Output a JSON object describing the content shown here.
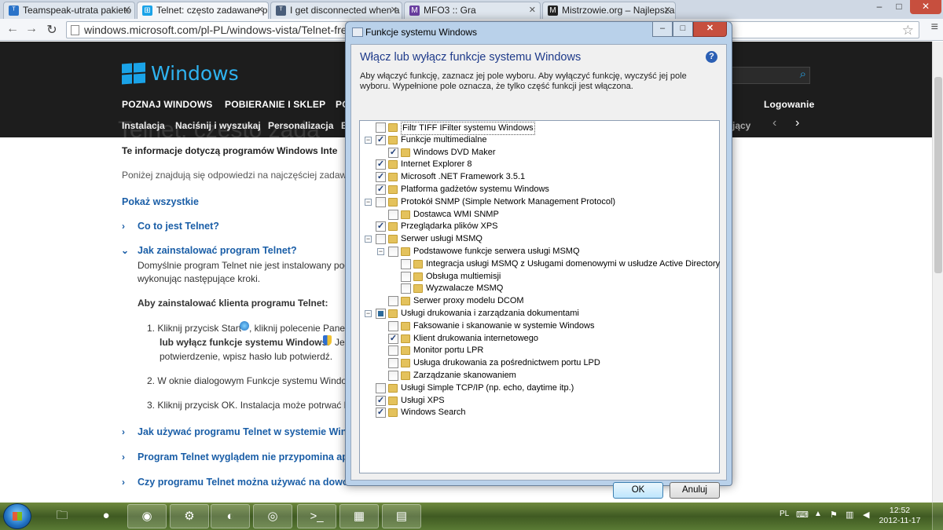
{
  "browser": {
    "tabs": [
      {
        "title": "Teamspeak-utrata pakietó",
        "icon": "teamspeak-icon",
        "color": "#2a73c9"
      },
      {
        "title": "Telnet: często zadawane p",
        "icon": "windows-flag-icon",
        "color": "#1aa3e8"
      },
      {
        "title": "I get disconnected when a",
        "icon": "teamspeak-icon",
        "color": "#4a5e7a"
      },
      {
        "title": "MFO3 :: Gra",
        "icon": "mfo-icon",
        "color": "#6a3fa0"
      },
      {
        "title": "Mistrzowie.org – Najlepsza",
        "icon": "m-icon",
        "color": "#222222"
      }
    ],
    "url": "windows.microsoft.com/pl-PL/windows-vista/Telnet-freq",
    "window_controls": {
      "minimize": "–",
      "maximize": "□",
      "close": "✕"
    }
  },
  "site": {
    "logo": "Windows",
    "nav": [
      "POZNAJ WINDOWS",
      "POBIERANIE I SKLEP",
      "PO"
    ],
    "login": "Logowanie",
    "subnav": [
      "Instalacja",
      "Naciśnij i wyszukaj",
      "Personalizacja",
      "B"
    ],
    "subnav_right": "jący",
    "ghost_title": "Telnet: często zada",
    "intro_bold": "Te informacje dotyczą programów Windows Inte",
    "intro": "Poniżej znajdują się odpowiedzi na najczęściej zadawan",
    "show_all": "Pokaż wszystkie",
    "q1": "Co to jest Telnet?",
    "q2": "Jak zainstalować program Telnet?",
    "q2_text1": "Domyślnie program Telnet nie jest instalowany pod",
    "q2_text2": "wykonując następujące kroki.",
    "q2_howto": "Aby zainstalować klienta programu Telnet:",
    "step1a": "1.  Kliknij przycisk Start",
    "step1b": ", kliknij polecenie Panel",
    "step1c": "lub wyłącz funkcje systemu Windows.",
    "step1d": "Jeś",
    "step1e": "potwierdzenie, wpisz hasło lub potwierdź.",
    "step2": "2.  W oknie dialogowym Funkcje systemu Windo",
    "step3": "3.  Kliknij przycisk OK. Instalacja może potrwać kil",
    "q3": "Jak używać programu Telnet w systemie Wind",
    "q4": "Program Telnet wyglądem nie przypomina ap",
    "q5": "Czy programu Telnet można używać na dowo"
  },
  "dialog": {
    "title": "Funkcje systemu Windows",
    "heading": "Włącz lub wyłącz funkcje systemu Windows",
    "description": "Aby włączyć funkcję, zaznacz jej pole wyboru. Aby wyłączyć funkcję, wyczyść jej pole wyboru. Wypełnione pole oznacza, że tylko część funkcji jest włączona.",
    "help": "?",
    "ok": "OK",
    "cancel": "Anuluj",
    "features": [
      {
        "label": "Filtr TIFF IFilter systemu Windows",
        "level": 0,
        "state": "unchecked",
        "expander": "",
        "selected": true
      },
      {
        "label": "Funkcje multimedialne",
        "level": 0,
        "state": "checked",
        "expander": "−"
      },
      {
        "label": "Windows DVD Maker",
        "level": 1,
        "state": "checked",
        "expander": ""
      },
      {
        "label": "Internet Explorer 8",
        "level": 0,
        "state": "checked",
        "expander": ""
      },
      {
        "label": "Microsoft .NET Framework 3.5.1",
        "level": 0,
        "state": "checked",
        "expander": ""
      },
      {
        "label": "Platforma gadżetów systemu Windows",
        "level": 0,
        "state": "checked",
        "expander": ""
      },
      {
        "label": "Protokół SNMP (Simple Network Management Protocol)",
        "level": 0,
        "state": "unchecked",
        "expander": "−"
      },
      {
        "label": "Dostawca WMI SNMP",
        "level": 1,
        "state": "unchecked",
        "expander": ""
      },
      {
        "label": "Przeglądarka plików XPS",
        "level": 0,
        "state": "checked",
        "expander": ""
      },
      {
        "label": "Serwer usługi MSMQ",
        "level": 0,
        "state": "unchecked",
        "expander": "−"
      },
      {
        "label": "Podstawowe funkcje serwera usługi MSMQ",
        "level": 1,
        "state": "unchecked",
        "expander": "−"
      },
      {
        "label": "Integracja usługi MSMQ z Usługami domenowymi w usłudze Active Directory",
        "level": 2,
        "state": "unchecked",
        "expander": ""
      },
      {
        "label": "Obsługa multiemisji",
        "level": 2,
        "state": "unchecked",
        "expander": ""
      },
      {
        "label": "Wyzwalacze MSMQ",
        "level": 2,
        "state": "unchecked",
        "expander": ""
      },
      {
        "label": "Serwer proxy modelu DCOM",
        "level": 1,
        "state": "unchecked",
        "expander": ""
      },
      {
        "label": "Usługi drukowania i zarządzania dokumentami",
        "level": 0,
        "state": "partial",
        "expander": "−"
      },
      {
        "label": "Faksowanie i skanowanie w systemie Windows",
        "level": 1,
        "state": "unchecked",
        "expander": ""
      },
      {
        "label": "Klient drukowania internetowego",
        "level": 1,
        "state": "checked",
        "expander": ""
      },
      {
        "label": "Monitor portu LPR",
        "level": 1,
        "state": "unchecked",
        "expander": ""
      },
      {
        "label": "Usługa drukowania za pośrednictwem portu LPD",
        "level": 1,
        "state": "unchecked",
        "expander": ""
      },
      {
        "label": "Zarządzanie skanowaniem",
        "level": 1,
        "state": "unchecked",
        "expander": ""
      },
      {
        "label": "Usługi Simple TCP/IP (np. echo, daytime itp.)",
        "level": 0,
        "state": "unchecked",
        "expander": ""
      },
      {
        "label": "Usługi XPS",
        "level": 0,
        "state": "checked",
        "expander": ""
      },
      {
        "label": "Windows Search",
        "level": 0,
        "state": "checked",
        "expander": ""
      }
    ]
  },
  "taskbar": {
    "items": [
      {
        "name": "explorer-icon",
        "glyph": "🗀",
        "open": false
      },
      {
        "name": "firefox-icon",
        "glyph": "●",
        "open": false
      },
      {
        "name": "chrome-icon",
        "glyph": "◉",
        "open": true
      },
      {
        "name": "steam-icon",
        "glyph": "⚙",
        "open": true
      },
      {
        "name": "teamspeak-icon",
        "glyph": "◐",
        "open": true
      },
      {
        "name": "cd-icon",
        "glyph": "◎",
        "open": true
      },
      {
        "name": "cmd-icon",
        "glyph": ">_",
        "open": true
      },
      {
        "name": "control-panel-icon",
        "glyph": "▦",
        "open": true
      },
      {
        "name": "features-icon",
        "glyph": "▤",
        "open": true
      }
    ],
    "language": "PL",
    "time": "12:52",
    "date": "2012-11-17"
  }
}
